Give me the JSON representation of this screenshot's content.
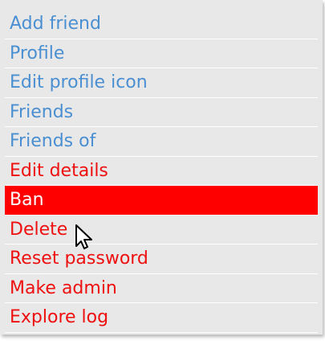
{
  "menu": {
    "items": [
      {
        "label": "Add friend",
        "tone": "blue",
        "active": false
      },
      {
        "label": "Profile",
        "tone": "blue",
        "active": false
      },
      {
        "label": "Edit profile icon",
        "tone": "blue",
        "active": false
      },
      {
        "label": "Friends",
        "tone": "blue",
        "active": false
      },
      {
        "label": "Friends of",
        "tone": "blue",
        "active": false
      },
      {
        "label": "Edit details",
        "tone": "red",
        "active": false
      },
      {
        "label": "Ban",
        "tone": "red",
        "active": true
      },
      {
        "label": "Delete",
        "tone": "red",
        "active": false
      },
      {
        "label": "Reset password",
        "tone": "red",
        "active": false
      },
      {
        "label": "Make admin",
        "tone": "red",
        "active": false
      },
      {
        "label": "Explore log",
        "tone": "red",
        "active": false
      }
    ]
  },
  "colors": {
    "menu_background": "#e8e8e8",
    "link_blue": "#4a8fd1",
    "link_red": "#ee1010",
    "active_background": "#ff0000",
    "active_text": "#ffffff"
  },
  "cursor": {
    "icon": "mouse-pointer-icon"
  }
}
